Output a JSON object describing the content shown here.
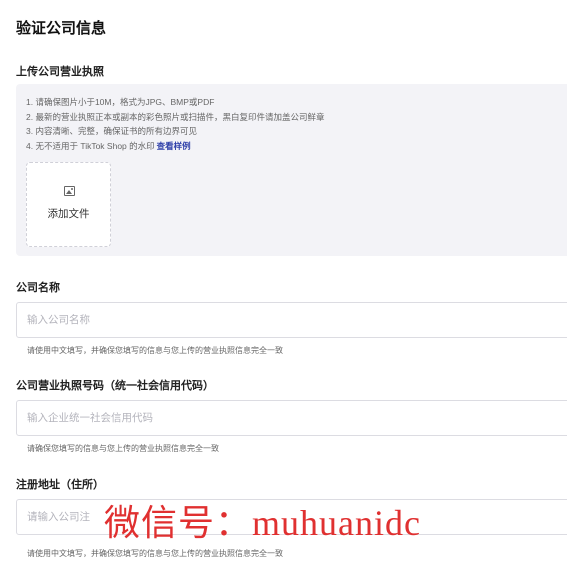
{
  "page": {
    "title": "验证公司信息"
  },
  "upload": {
    "label": "上传公司营业执照",
    "instructions": [
      "1. 请确保图片小于10M，格式为JPG、BMP或PDF",
      "2. 最新的营业执照正本或副本的彩色照片或扫描件，黑白复印件请加盖公司鲜章",
      "3. 内容清晰、完整，确保证书的所有边界可见",
      "4. 无不适用于 TikTok Shop 的水印"
    ],
    "sample_link": "查看样例",
    "button_label": "添加文件",
    "icon": "image-icon"
  },
  "company_name": {
    "label": "公司名称",
    "placeholder": "输入公司名称",
    "value": "",
    "hint": "请使用中文填写，并确保您填写的信息与您上传的营业执照信息完全一致"
  },
  "license_number": {
    "label": "公司营业执照号码（统一社会信用代码）",
    "placeholder": "输入企业统一社会信用代码",
    "value": "",
    "hint": "请确保您填写的信息与您上传的营业执照信息完全一致"
  },
  "address": {
    "label": "注册地址（住所）",
    "placeholder": "请输入公司注",
    "value": "",
    "hint": "请使用中文填写，并确保您填写的信息与您上传的营业执照信息完全一致"
  },
  "watermark": {
    "text": "微信号：muhuanidc",
    "color": "#e03030"
  }
}
